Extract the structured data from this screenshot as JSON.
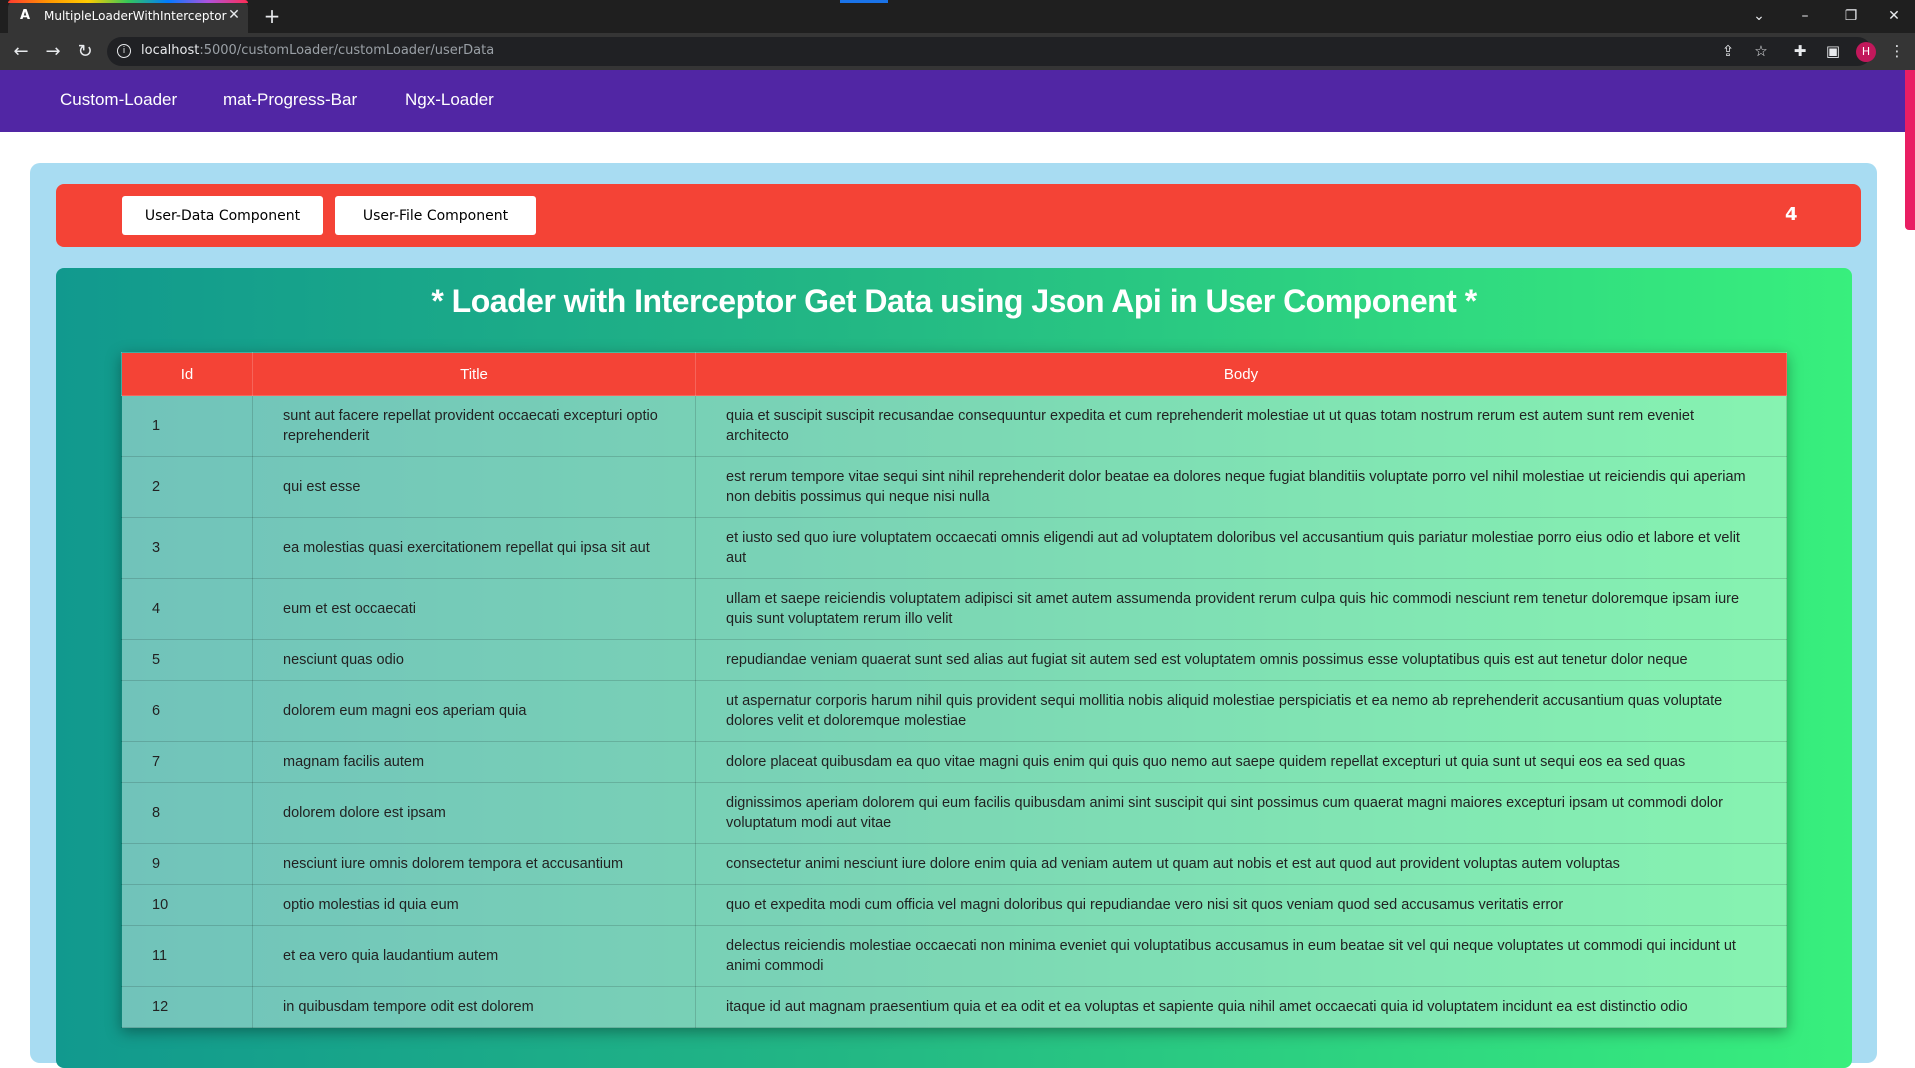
{
  "browser": {
    "tab_title": "MultipleLoaderWithInterceptor",
    "tab_favicon": "A",
    "url_host": "localhost",
    "url_path": ":5000/customLoader/customLoader/userData",
    "avatar_letter": "H"
  },
  "nav": {
    "links": [
      "Custom-Loader",
      "mat-Progress-Bar",
      "Ngx-Loader"
    ]
  },
  "toolbar": {
    "user_data_button": "User-Data Component",
    "user_file_button": "User-File Component",
    "counter": "4"
  },
  "main": {
    "heading": "* Loader with Interceptor Get Data using Json Api in User Component *"
  },
  "table": {
    "headers": [
      "Id",
      "Title",
      "Body"
    ],
    "rows": [
      {
        "id": "1",
        "title": "sunt aut facere repellat provident occaecati excepturi optio reprehenderit",
        "body": "quia et suscipit suscipit recusandae consequuntur expedita et cum reprehenderit molestiae ut ut quas totam nostrum rerum est autem sunt rem eveniet architecto"
      },
      {
        "id": "2",
        "title": "qui est esse",
        "body": "est rerum tempore vitae sequi sint nihil reprehenderit dolor beatae ea dolores neque fugiat blanditiis voluptate porro vel nihil molestiae ut reiciendis qui aperiam non debitis possimus qui neque nisi nulla"
      },
      {
        "id": "3",
        "title": "ea molestias quasi exercitationem repellat qui ipsa sit aut",
        "body": "et iusto sed quo iure voluptatem occaecati omnis eligendi aut ad voluptatem doloribus vel accusantium quis pariatur molestiae porro eius odio et labore et velit aut"
      },
      {
        "id": "4",
        "title": "eum et est occaecati",
        "body": "ullam et saepe reiciendis voluptatem adipisci sit amet autem assumenda provident rerum culpa quis hic commodi nesciunt rem tenetur doloremque ipsam iure quis sunt voluptatem rerum illo velit"
      },
      {
        "id": "5",
        "title": "nesciunt quas odio",
        "body": "repudiandae veniam quaerat sunt sed alias aut fugiat sit autem sed est voluptatem omnis possimus esse voluptatibus quis est aut tenetur dolor neque"
      },
      {
        "id": "6",
        "title": "dolorem eum magni eos aperiam quia",
        "body": "ut aspernatur corporis harum nihil quis provident sequi mollitia nobis aliquid molestiae perspiciatis et ea nemo ab reprehenderit accusantium quas voluptate dolores velit et doloremque molestiae"
      },
      {
        "id": "7",
        "title": "magnam facilis autem",
        "body": "dolore placeat quibusdam ea quo vitae magni quis enim qui quis quo nemo aut saepe quidem repellat excepturi ut quia sunt ut sequi eos ea sed quas"
      },
      {
        "id": "8",
        "title": "dolorem dolore est ipsam",
        "body": "dignissimos aperiam dolorem qui eum facilis quibusdam animi sint suscipit qui sint possimus cum quaerat magni maiores excepturi ipsam ut commodi dolor voluptatum modi aut vitae"
      },
      {
        "id": "9",
        "title": "nesciunt iure omnis dolorem tempora et accusantium",
        "body": "consectetur animi nesciunt iure dolore enim quia ad veniam autem ut quam aut nobis et est aut quod aut provident voluptas autem voluptas"
      },
      {
        "id": "10",
        "title": "optio molestias id quia eum",
        "body": "quo et expedita modi cum officia vel magni doloribus qui repudiandae vero nisi sit quos veniam quod sed accusamus veritatis error"
      },
      {
        "id": "11",
        "title": "et ea vero quia laudantium autem",
        "body": "delectus reiciendis molestiae occaecati non minima eveniet qui voluptatibus accusamus in eum beatae sit vel qui neque voluptates ut commodi qui incidunt ut animi commodi"
      },
      {
        "id": "12",
        "title": "in quibusdam tempore odit est dolorem",
        "body": "itaque id aut magnam praesentium quia et ea odit et ea voluptas et sapiente quia nihil amet occaecati quia id voluptatem incidunt ea est distinctio odio"
      }
    ]
  },
  "colors": {
    "nav_bg": "#5126a4",
    "redbar_bg": "#f44336",
    "outer_bg": "#a8dcf2",
    "panel_gradient_start": "#11998e",
    "panel_gradient_end": "#38ef7d"
  },
  "icons": [
    "back-arrow-icon",
    "forward-arrow-icon",
    "reload-icon",
    "info-icon",
    "share-icon",
    "star-icon",
    "extensions-icon",
    "side-panel-icon",
    "menu-dots-icon",
    "close-icon",
    "plus-icon",
    "chevron-down-icon",
    "minimize-icon",
    "restore-icon"
  ]
}
